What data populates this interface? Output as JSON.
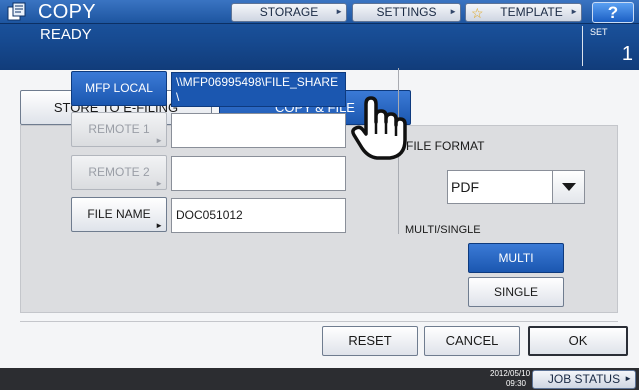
{
  "header": {
    "app_title": "COPY",
    "storage_label": "STORAGE",
    "settings_label": "SETTINGS",
    "template_label": "TEMPLATE",
    "help_label": "?",
    "status": "READY",
    "set_label": "SET",
    "set_value": "1",
    "icons": {
      "app": "copy-icon",
      "template": "star-icon"
    }
  },
  "tabs": {
    "store_label": "STORE TO E-FILING",
    "copyfile_label": "COPY & FILE",
    "active": "COPY & FILE"
  },
  "destinations": {
    "mfp_local_label": "MFP LOCAL",
    "mfp_local_value": "\\\\MFP06995498\\FILE_SHARE\\",
    "remote1_label": "REMOTE 1",
    "remote1_value": "",
    "remote2_label": "REMOTE 2",
    "remote2_value": "",
    "file_name_label": "FILE NAME",
    "file_name_value": "DOC051012"
  },
  "file_format": {
    "label": "FILE FORMAT",
    "selected": "PDF",
    "multi_single_label": "MULTI/SINGLE",
    "multi_label": "MULTI",
    "single_label": "SINGLE",
    "selected_mode": "MULTI"
  },
  "footer": {
    "reset_label": "RESET",
    "cancel_label": "CANCEL",
    "ok_label": "OK"
  },
  "statusbar": {
    "date": "2012/05/10",
    "time": "09:30",
    "job_status_label": "JOB STATUS"
  },
  "colors": {
    "header_blue": "#174b92",
    "active_blue": "#1b57b0",
    "panel_gray": "#dcdde0",
    "bottom_bar": "#2c2d31"
  }
}
